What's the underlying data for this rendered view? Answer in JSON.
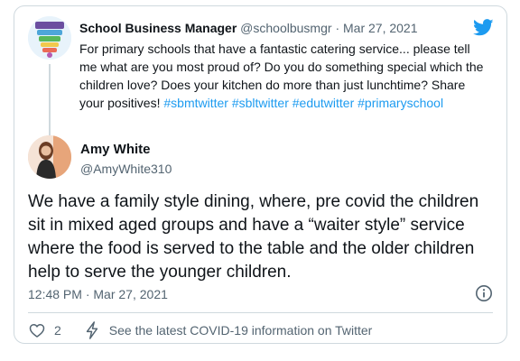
{
  "parent": {
    "name": "School Business Manager",
    "handle": "@schoolbusmgr",
    "separator": "·",
    "date": "Mar 27, 2021",
    "text": "For primary schools that have a fantastic catering service... please tell me what are you most proud of? Do you do something special which the children love? Does your kitchen  do more than just lunchtime? Share your positives!",
    "hashtags": [
      "#sbmtwitter",
      "#sbltwitter",
      "#edutwitter",
      "#primaryschool"
    ]
  },
  "reply": {
    "name": "Amy White",
    "handle": "@AmyWhite310",
    "text": "We have a family style dining, where, pre covid the children sit in mixed aged groups and have a “waiter style” service where the food is served to the table and the older children help to serve the younger children.",
    "time": "12:48 PM",
    "separator": "·",
    "date": "Mar 27, 2021"
  },
  "actions": {
    "like_count": "2",
    "covid_label": "See the latest COVID-19 information on Twitter"
  },
  "icons": {
    "brand": "twitter-bird-icon",
    "info": "info-icon",
    "like": "heart-icon",
    "covid": "lightning-icon"
  },
  "colors": {
    "accent": "#1d9bf0",
    "muted_text": "#536471",
    "border": "#cfd9de"
  }
}
